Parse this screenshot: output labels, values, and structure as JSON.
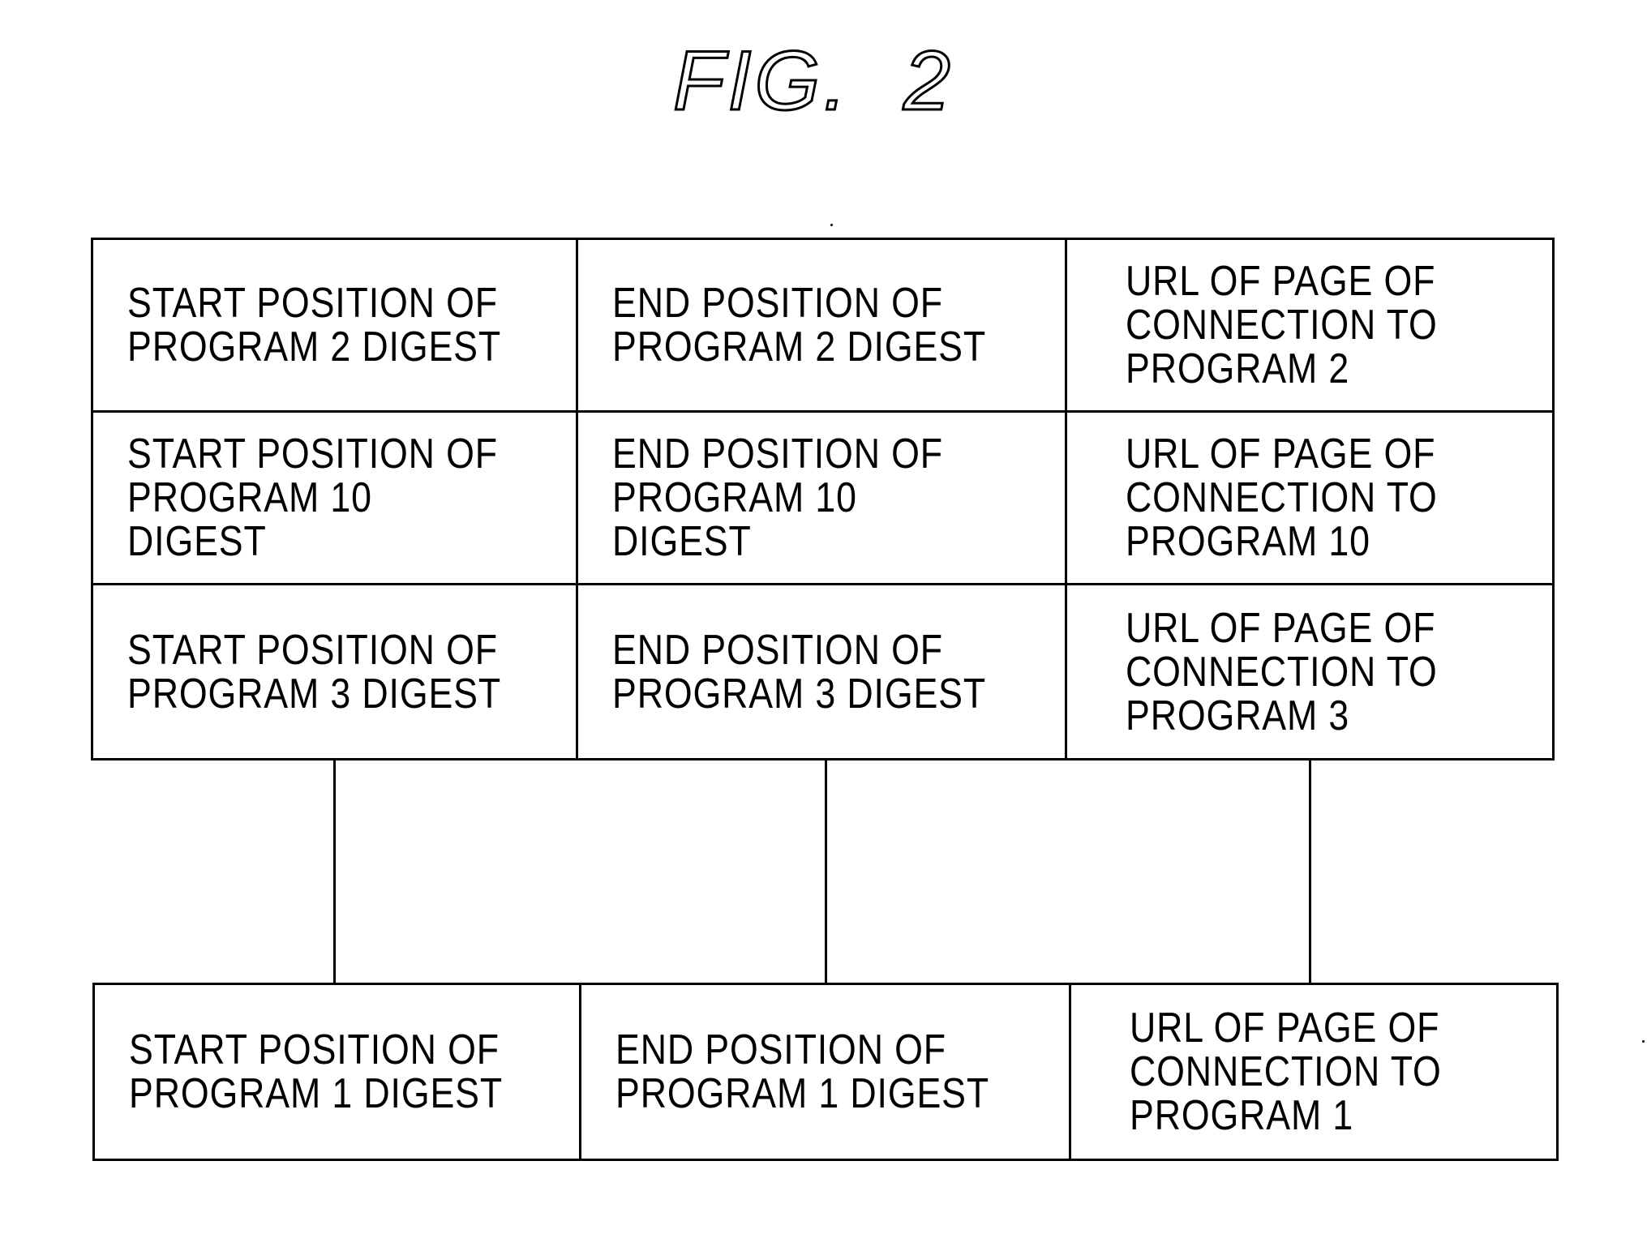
{
  "figure": {
    "title": "FIG.  2"
  },
  "top_table": {
    "rows": [
      {
        "start": "START POSITION OF\nPROGRAM 2 DIGEST",
        "end": "END POSITION OF\nPROGRAM 2 DIGEST",
        "url": "URL OF PAGE OF\nCONNECTION TO\nPROGRAM 2"
      },
      {
        "start": "START POSITION OF\nPROGRAM 10 DIGEST",
        "end": "END POSITION OF\nPROGRAM 10 DIGEST",
        "url": "URL OF PAGE OF\nCONNECTION TO\nPROGRAM 10"
      },
      {
        "start": "START POSITION OF\nPROGRAM 3 DIGEST",
        "end": "END POSITION OF\nPROGRAM 3 DIGEST",
        "url": "URL OF PAGE OF\nCONNECTION TO\nPROGRAM 3"
      }
    ]
  },
  "bottom_table": {
    "start": "START POSITION OF\nPROGRAM 1 DIGEST",
    "end": "END POSITION OF\nPROGRAM 1 DIGEST",
    "url": "URL OF PAGE OF\nCONNECTION TO\nPROGRAM 1"
  }
}
